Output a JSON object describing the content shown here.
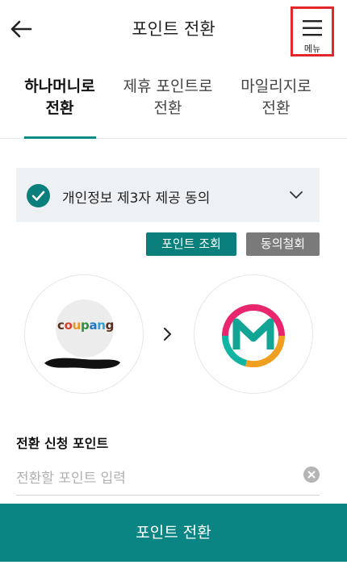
{
  "header": {
    "title": "포인트 전환",
    "back_icon": "arrow-left-icon",
    "menu_icon": "hamburger-menu-icon",
    "menu_label": "메뉴",
    "menu_highlight_color": "#e2262b"
  },
  "tabs": [
    {
      "line1": "하나머니로",
      "line2": "전환",
      "active": true
    },
    {
      "line1": "제휴 포인트로",
      "line2": "전환",
      "active": false
    },
    {
      "line1": "마일리지로",
      "line2": "전환",
      "active": false
    }
  ],
  "consent": {
    "label": "개인정보 제3자 제공 동의",
    "checked": true,
    "check_icon": "check-circle-icon",
    "chevron_icon": "chevron-down-icon"
  },
  "actions": {
    "lookup_label": "포인트 조회",
    "withdraw_label": "동의철회"
  },
  "conversion": {
    "source_brand": "coupang",
    "target_logo_icon": "m-point-logo-icon",
    "arrow_icon": "chevron-right-icon"
  },
  "input": {
    "title": "전환 신청 포인트",
    "placeholder": "전환할 포인트 입력",
    "value": "",
    "clear_icon": "clear-circle-icon"
  },
  "cta": {
    "label": "포인트 전환"
  },
  "colors": {
    "accent": "#0b8583",
    "tab_underline": "#0b8b87",
    "withdraw_gray": "#7a7a7a",
    "consent_bg": "#eef1f4"
  }
}
